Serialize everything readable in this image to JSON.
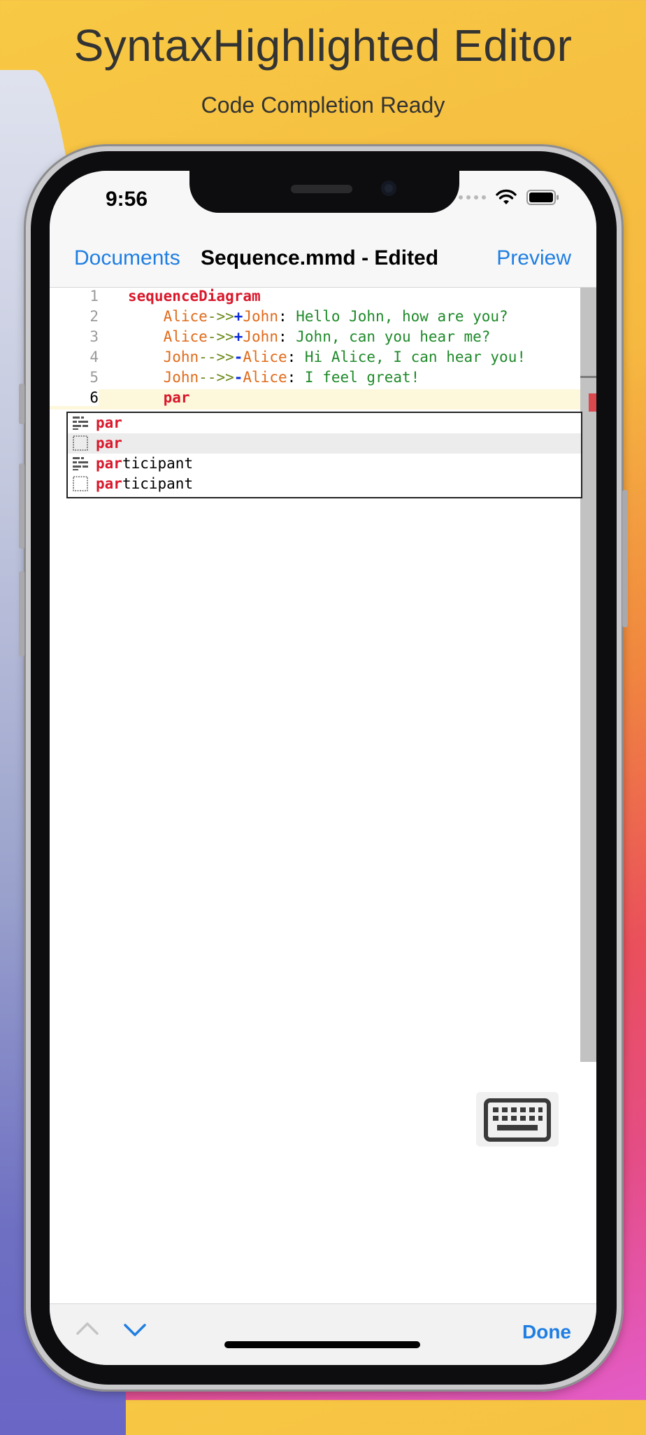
{
  "promo": {
    "title": "SyntaxHighlighted Editor",
    "subtitle": "Code Completion Ready"
  },
  "status_bar": {
    "time": "9:56"
  },
  "nav": {
    "back_label": "Documents",
    "title": "Sequence.mmd - Edited",
    "action_label": "Preview"
  },
  "editor": {
    "current_line": 6,
    "lines": [
      {
        "num": "1",
        "tokens": [
          {
            "t": "sequenceDiagram",
            "c": "kw"
          }
        ]
      },
      {
        "num": "2",
        "tokens": [
          {
            "t": "    "
          },
          {
            "t": "Alice",
            "c": "ac"
          },
          {
            "t": "->>",
            "c": "ar"
          },
          {
            "t": "+",
            "c": "pl"
          },
          {
            "t": "John",
            "c": "ac"
          },
          {
            "t": ": ",
            "c": "cl"
          },
          {
            "t": "Hello John, how are you?",
            "c": "tx"
          }
        ]
      },
      {
        "num": "3",
        "tokens": [
          {
            "t": "    "
          },
          {
            "t": "Alice",
            "c": "ac"
          },
          {
            "t": "->>",
            "c": "ar"
          },
          {
            "t": "+",
            "c": "pl"
          },
          {
            "t": "John",
            "c": "ac"
          },
          {
            "t": ": ",
            "c": "cl"
          },
          {
            "t": "John, can you hear me?",
            "c": "tx"
          }
        ]
      },
      {
        "num": "4",
        "tokens": [
          {
            "t": "    "
          },
          {
            "t": "John",
            "c": "ac"
          },
          {
            "t": "-->>",
            "c": "ar"
          },
          {
            "t": "-",
            "c": "pl"
          },
          {
            "t": "Alice",
            "c": "ac"
          },
          {
            "t": ": ",
            "c": "cl"
          },
          {
            "t": "Hi Alice, I can hear you!",
            "c": "tx"
          }
        ]
      },
      {
        "num": "5",
        "tokens": [
          {
            "t": "    "
          },
          {
            "t": "John",
            "c": "ac"
          },
          {
            "t": "-->>",
            "c": "ar"
          },
          {
            "t": "-",
            "c": "pl"
          },
          {
            "t": "Alice",
            "c": "ac"
          },
          {
            "t": ": ",
            "c": "cl"
          },
          {
            "t": "I feel great!",
            "c": "tx"
          }
        ]
      },
      {
        "num": "6",
        "tokens": [
          {
            "t": "    "
          },
          {
            "t": "par",
            "c": "kw"
          }
        ]
      }
    ]
  },
  "completion": {
    "typed_prefix": "par",
    "selected_index": 1,
    "items": [
      {
        "match": "par",
        "rest": "",
        "icon": "snippet-icon"
      },
      {
        "match": "par",
        "rest": "",
        "icon": "keyword-icon"
      },
      {
        "match": "par",
        "rest": "ticipant",
        "icon": "snippet-icon"
      },
      {
        "match": "par",
        "rest": "ticipant",
        "icon": "keyword-icon"
      }
    ]
  },
  "keyboard_button": {
    "icon": "keyboard-icon"
  },
  "toolbar": {
    "prev_icon": "chevron-up-icon",
    "next_icon": "chevron-down-icon",
    "done_label": "Done"
  },
  "colors": {
    "tint": "#1f7ee2",
    "keyword": "#d9182b",
    "actor": "#e06a1a",
    "arrow": "#6c8a1a",
    "activation": "#0a2bd8",
    "message": "#1f8a2a",
    "current_line_bg": "#fdf7dc"
  }
}
